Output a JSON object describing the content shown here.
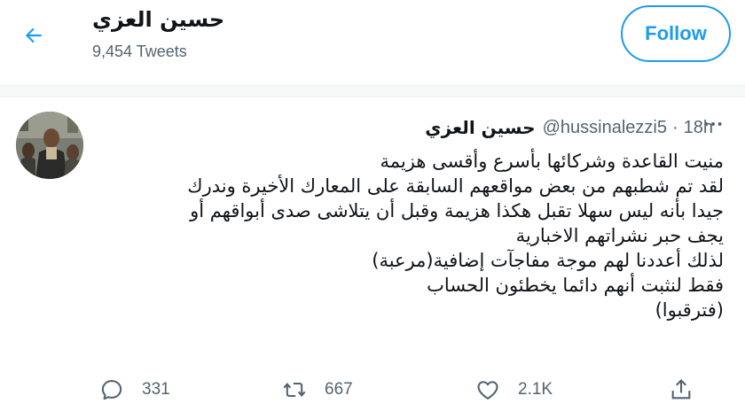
{
  "header": {
    "title": "حسين العزي",
    "tweet_count": "9,454 Tweets",
    "follow_label": "Follow"
  },
  "tweet": {
    "author_name": "حسين العزي",
    "handle": "@hussinalezzi5",
    "separator": "·",
    "time": "18h",
    "lines": [
      "منيت القاعدة وشركائها بأسرع وأقسى هزيمة",
      "لقد تم شطبهم من بعض مواقعهم السابقة على المعارك الأخيرة وندرك",
      "جيدا بأنه ليس سهلا تقبل هكذا هزيمة وقبل أن يتلاشى صدى أبواقهم أو",
      "يجف حبر نشراتهم الاخبارية",
      "لذلك أعددنا لهم موجة مفاجآت إضافية(مرعبة)",
      "فقط لنثبت أنهم دائما يخطئون الحساب",
      "(فترقبوا)"
    ],
    "actions": {
      "replies": "331",
      "retweets": "667",
      "likes": "2.1K"
    }
  },
  "icons": {
    "back": "arrow-left-icon",
    "more": "more-icon",
    "reply": "reply-icon",
    "retweet": "retweet-icon",
    "like": "heart-icon",
    "share": "share-icon"
  },
  "colors": {
    "accent": "#1d9bf0",
    "secondary_text": "#536471",
    "primary_text": "#0f1419"
  }
}
